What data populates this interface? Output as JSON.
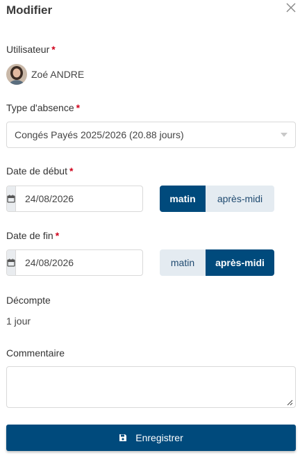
{
  "header": {
    "title": "Modifier",
    "close_icon": "close-icon"
  },
  "form": {
    "required_marker": "*",
    "user": {
      "label": "Utilisateur",
      "name": "Zoé ANDRE",
      "avatar_icon": "avatar"
    },
    "absence_type": {
      "label": "Type d'absence",
      "value": "Congés Payés 2025/2026 (20.88 jours)"
    },
    "start": {
      "label": "Date de début",
      "date": "24/08/2026",
      "morning": "matin",
      "afternoon": "après-midi",
      "selected": "matin"
    },
    "end": {
      "label": "Date de fin",
      "date": "24/08/2026",
      "morning": "matin",
      "afternoon": "après-midi",
      "selected": "après-midi"
    },
    "count": {
      "label": "Décompte",
      "value": "1 jour"
    },
    "comment": {
      "label": "Commentaire",
      "value": ""
    },
    "save": {
      "label": "Enregistrer",
      "icon": "save-icon"
    }
  },
  "colors": {
    "primary": "#004a7c",
    "toggle_inactive": "#e4ebf1",
    "required": "#d0021b",
    "addon_bg": "#e9ecef"
  }
}
